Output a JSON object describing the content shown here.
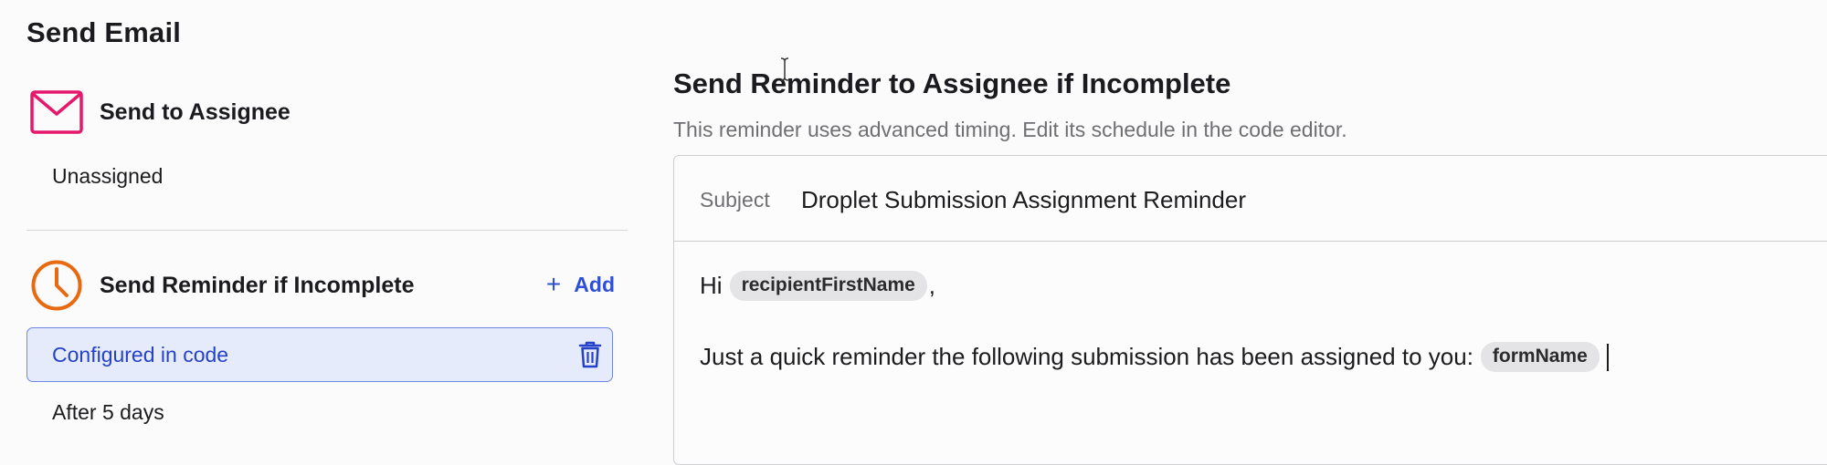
{
  "page": {
    "title": "Send Email"
  },
  "left": {
    "assignee": {
      "icon": "mail-icon",
      "title": "Send to Assignee",
      "value": "Unassigned"
    },
    "reminder": {
      "icon": "clock-icon",
      "title": "Send Reminder if Incomplete",
      "add_label": "Add",
      "config_label": "Configured in code",
      "delay_text": "After 5 days"
    }
  },
  "right": {
    "title": "Send Reminder to Assignee if Incomplete",
    "subtitle": "This reminder uses advanced timing. Edit its schedule in the code editor.",
    "subject_label": "Subject",
    "subject_value": "Droplet Submission Assignment Reminder",
    "body": {
      "greeting": "Hi",
      "greeting_var": "recipientFirstName",
      "greeting_end": ",",
      "line2_text": "Just a quick reminder the following submission has been assigned to you:",
      "line2_var": "formName"
    }
  },
  "colors": {
    "mail_icon": "#e5186b",
    "clock_icon": "#e86a10",
    "accent_blue": "#2f4fd6",
    "config_bg": "#e6ebfb"
  }
}
